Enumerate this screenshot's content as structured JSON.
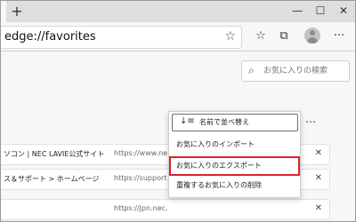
{
  "browser": {
    "newtab_glyph": "+",
    "window_controls": [
      "—",
      "☐",
      "✕"
    ],
    "address": "edge://favorites",
    "toolbar_icons": [
      "star-icon",
      "collections-icon",
      "profile-avatar",
      "more-icon"
    ]
  },
  "favorites": {
    "search_placeholder": "お気に入りの検索",
    "more_label": "…",
    "rows": [
      {
        "title": "ソコン | NEC LAVIE公式サイト",
        "url": "https://www.nec-lavie",
        "close": "✕"
      },
      {
        "title": "ス＆サポート > ホームページ",
        "url": "https://support.nec",
        "close": "✕"
      },
      {
        "title": "",
        "url": "https://jpn.nec.com/",
        "close": "✕"
      }
    ]
  },
  "menu": {
    "sort_label": "名前で並べ替え",
    "items": [
      "お気に入りのインポート",
      "お気に入りのエクスポート",
      "重複するお気に入りの削除"
    ],
    "highlight_color": "#d9232e"
  }
}
